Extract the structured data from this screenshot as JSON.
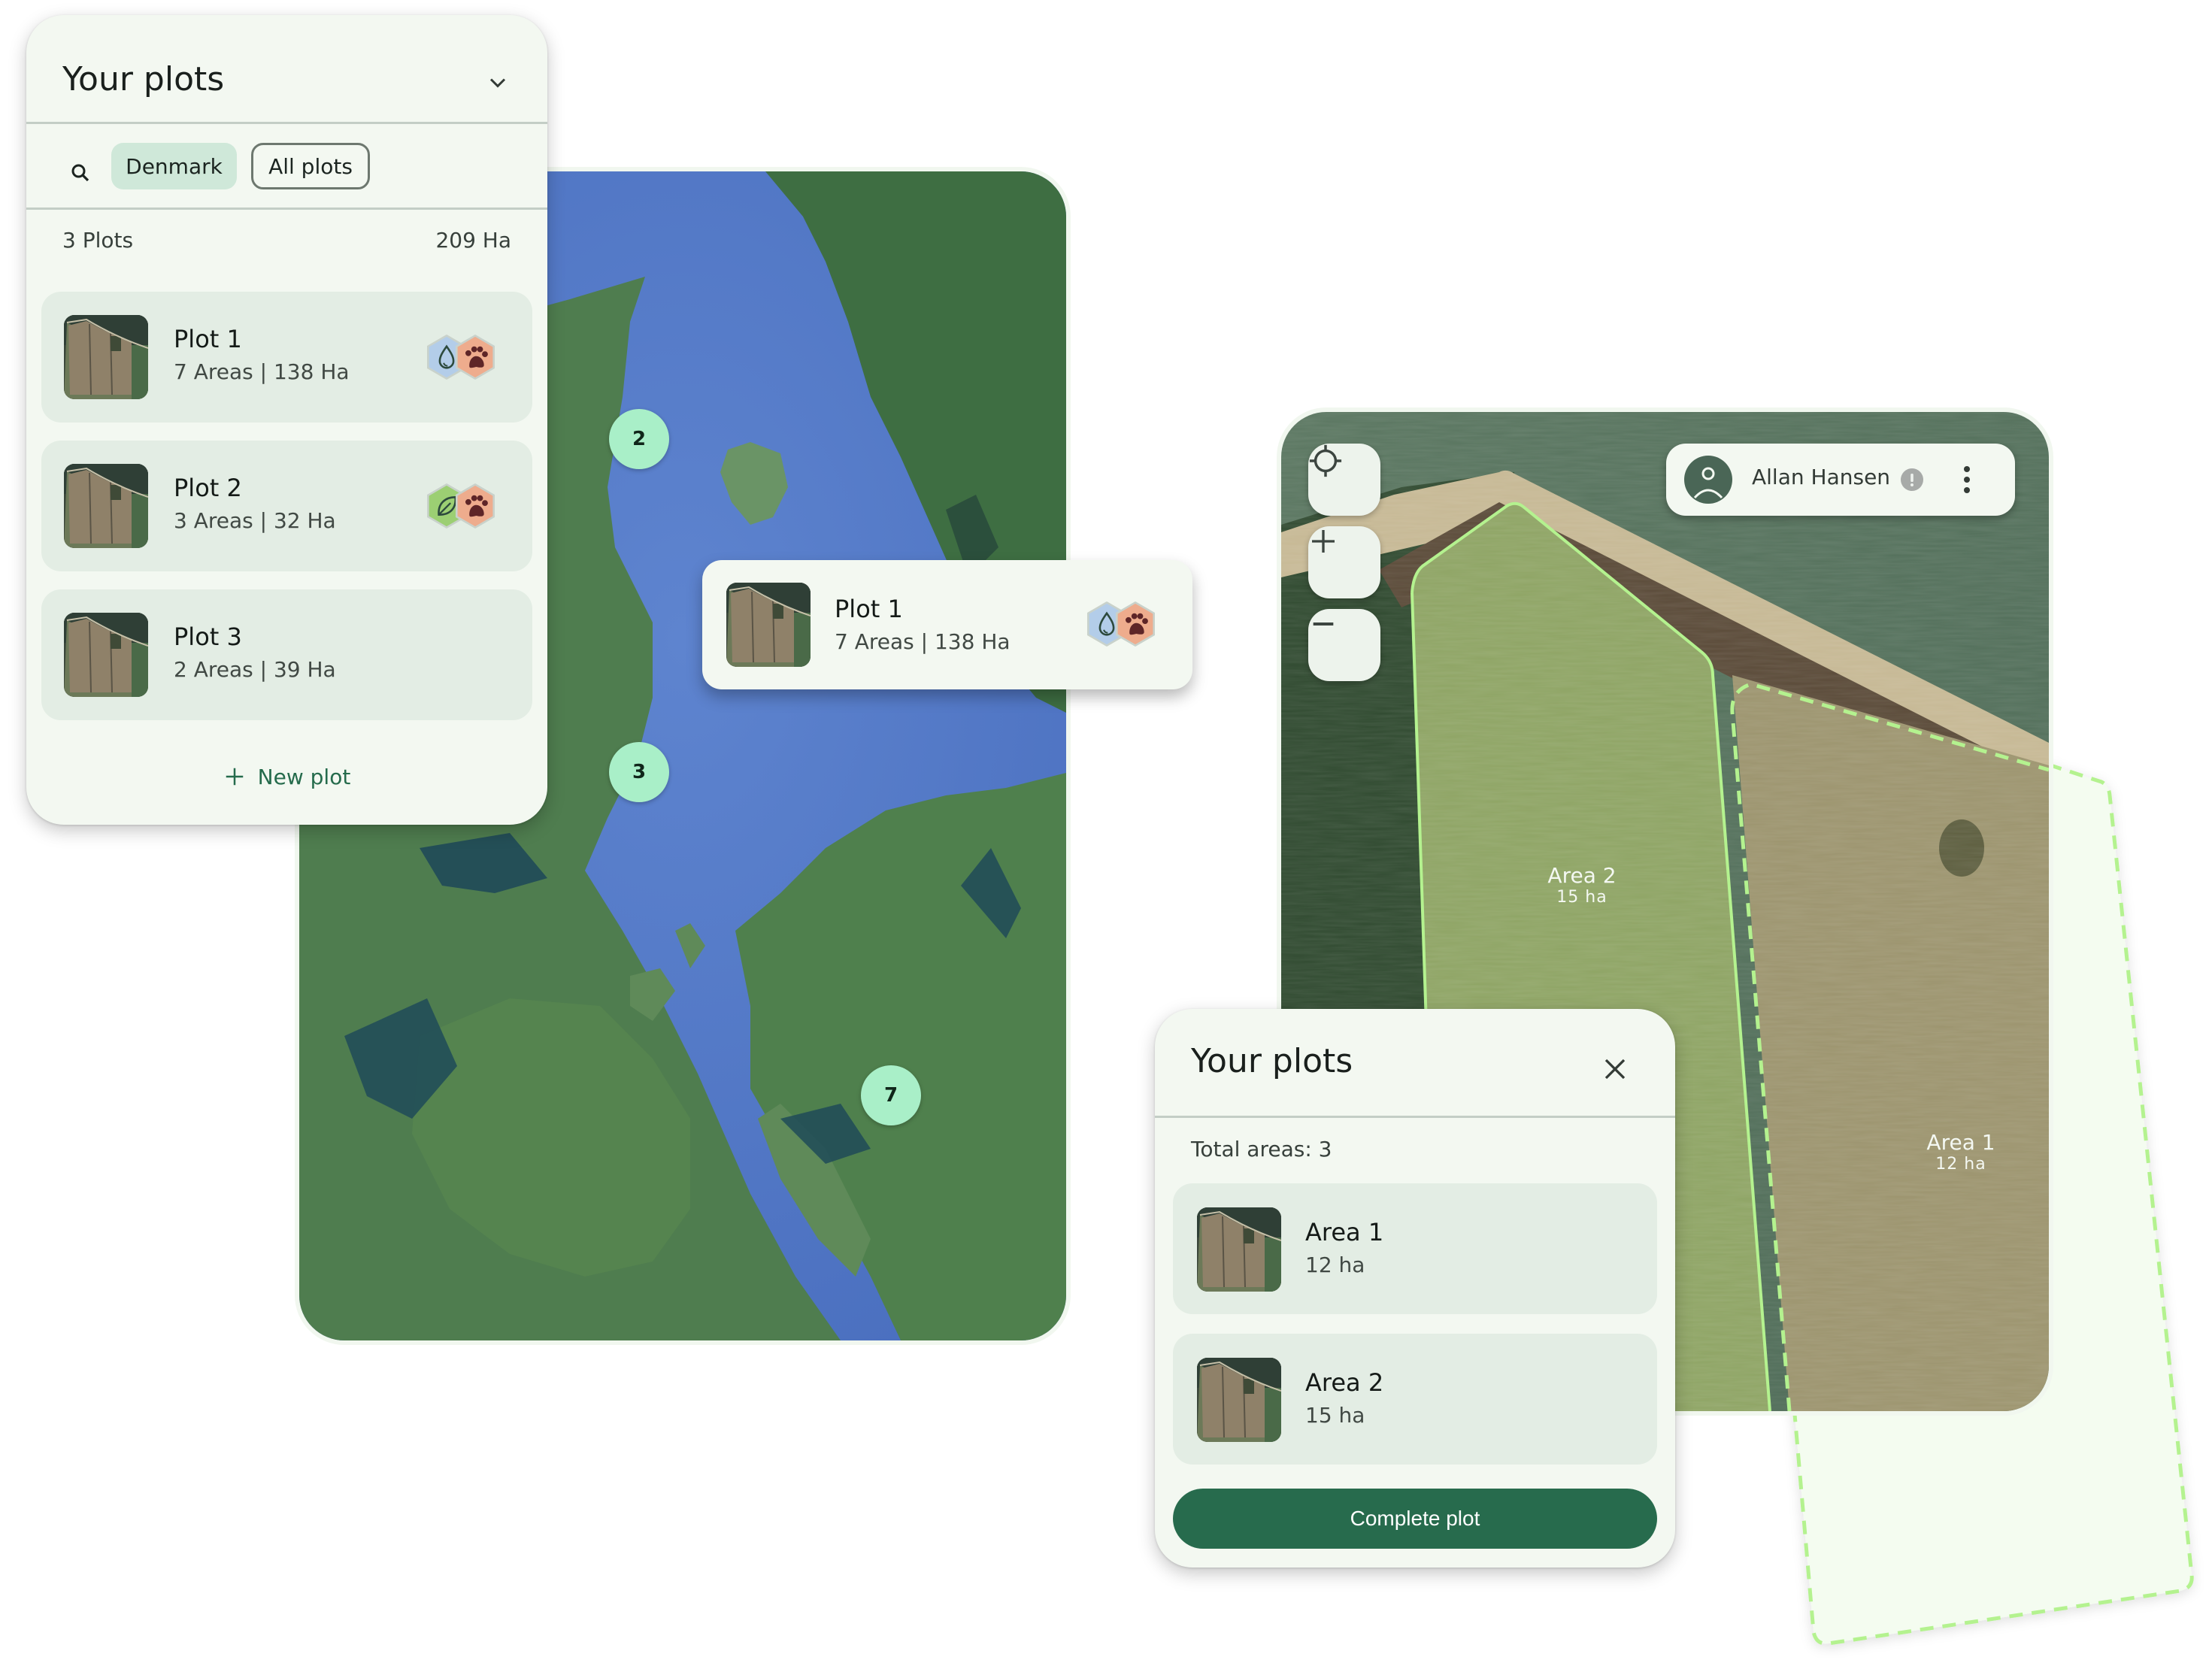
{
  "colors": {
    "accent": "#276b4d",
    "panel_bg": "#f3f8f1",
    "card_bg": "#e3ede4",
    "chip_selected_bg": "#cfe8d9",
    "marker_bg": "#a9efc8",
    "water_badge": "#b3cde9",
    "wildlife_badge": "#eeac8d",
    "nature_badge": "#9ccf73",
    "area_outline": "#b4f28f"
  },
  "plots_panel": {
    "title": "Your plots",
    "collapse_icon": "chevron-down-icon",
    "search_icon": "search-icon",
    "filters": [
      {
        "label": "Denmark",
        "selected": true
      },
      {
        "label": "All plots",
        "selected": false
      }
    ],
    "summary_count": "3 Plots",
    "summary_area": "209 Ha",
    "plots": [
      {
        "title": "Plot 1",
        "subtitle": "7 Areas | 138 Ha",
        "badges": [
          "water-drop-icon",
          "paw-icon"
        ]
      },
      {
        "title": "Plot 2",
        "subtitle": "3 Areas | 32 Ha",
        "badges": [
          "leaf-icon",
          "paw-icon"
        ]
      },
      {
        "title": "Plot 3",
        "subtitle": "2 Areas | 39 Ha",
        "badges": []
      }
    ],
    "new_plot_label": "New plot"
  },
  "overview_map": {
    "markers": [
      {
        "label": "2"
      },
      {
        "label": "3"
      },
      {
        "label": "7"
      }
    ],
    "popup": {
      "title": "Plot 1",
      "subtitle": "7 Areas | 138 Ha",
      "badges": [
        "water-drop-icon",
        "paw-icon"
      ]
    }
  },
  "detail_map": {
    "controls": [
      "my-location-icon",
      "zoom-in-icon",
      "zoom-out-icon"
    ],
    "user": {
      "name": "Allan Hansen",
      "status_icon": "alert-icon",
      "menu_icon": "more-vertical-icon"
    },
    "areas": [
      {
        "name": "Area 2",
        "size": "15 ha",
        "style": "solid"
      },
      {
        "name": "Area 1",
        "size": "12 ha",
        "style": "dashed"
      }
    ]
  },
  "areas_panel": {
    "title": "Your plots",
    "close_icon": "close-icon",
    "total": "Total areas: 3",
    "areas": [
      {
        "title": "Area 1",
        "subtitle": "12 ha"
      },
      {
        "title": "Area 2",
        "subtitle": "15 ha"
      }
    ],
    "complete_label": "Complete plot"
  }
}
